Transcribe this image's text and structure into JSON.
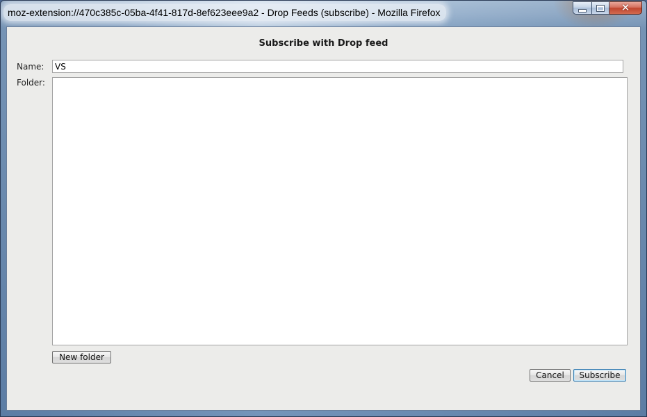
{
  "window": {
    "title": "moz-extension://470c385c-05ba-4f41-817d-8ef623eee9a2 - Drop Feeds (subscribe) - Mozilla Firefox",
    "controls": {
      "minimize_icon": "minimize-icon",
      "maximize_icon": "maximize-icon",
      "close_icon": "close-icon",
      "close_glyph": "✕"
    }
  },
  "dialog": {
    "title": "Subscribe with Drop feed",
    "name_label": "Name:",
    "name_value": "VS",
    "folder_label": "Folder:",
    "folder_items": [],
    "new_folder_label": "New folder",
    "cancel_label": "Cancel",
    "subscribe_label": "Subscribe"
  },
  "colors": {
    "client_background": "#ececea",
    "close_button": "#c0452f",
    "default_button_border": "#3c7fb1"
  }
}
